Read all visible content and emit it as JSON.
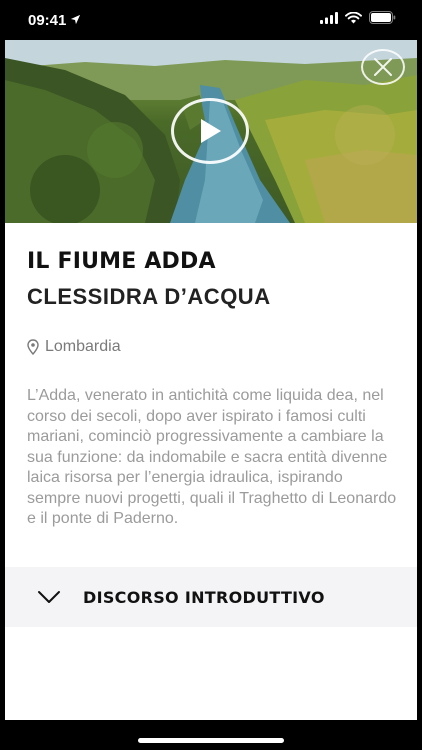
{
  "status_bar": {
    "time": "09:41",
    "icons": [
      "location-arrow-icon",
      "cellular-signal-icon",
      "wifi-icon",
      "battery-icon"
    ]
  },
  "hero": {
    "media": "aerial-river-photo",
    "play_icon": "play-icon",
    "close_icon": "close-icon"
  },
  "place": {
    "title": "IL FIUME ADDA",
    "subtitle": "CLESSIDRA D’ACQUA",
    "location": "Lombardia",
    "location_icon": "map-pin-icon",
    "description": "L’Adda, venerato in antichità come liquida dea, nel corso dei secoli, dopo aver ispirato i famosi culti mariani, cominciò progressivamente a cambiare la sua funzione: da indomabile e sacra entità divenne laica risorsa per l’energia idraulica, ispirando sempre nuovi progetti, quali il Traghetto di Leonardo e il ponte di Paderno."
  },
  "accordion": {
    "label": "DISCORSO INTRODUTTIVO",
    "icon": "chevron-down-icon"
  },
  "colors": {
    "background": "#000000",
    "card": "#ffffff",
    "accordion_bg": "#f4f3f6",
    "text_muted": "#9b9b9b"
  }
}
